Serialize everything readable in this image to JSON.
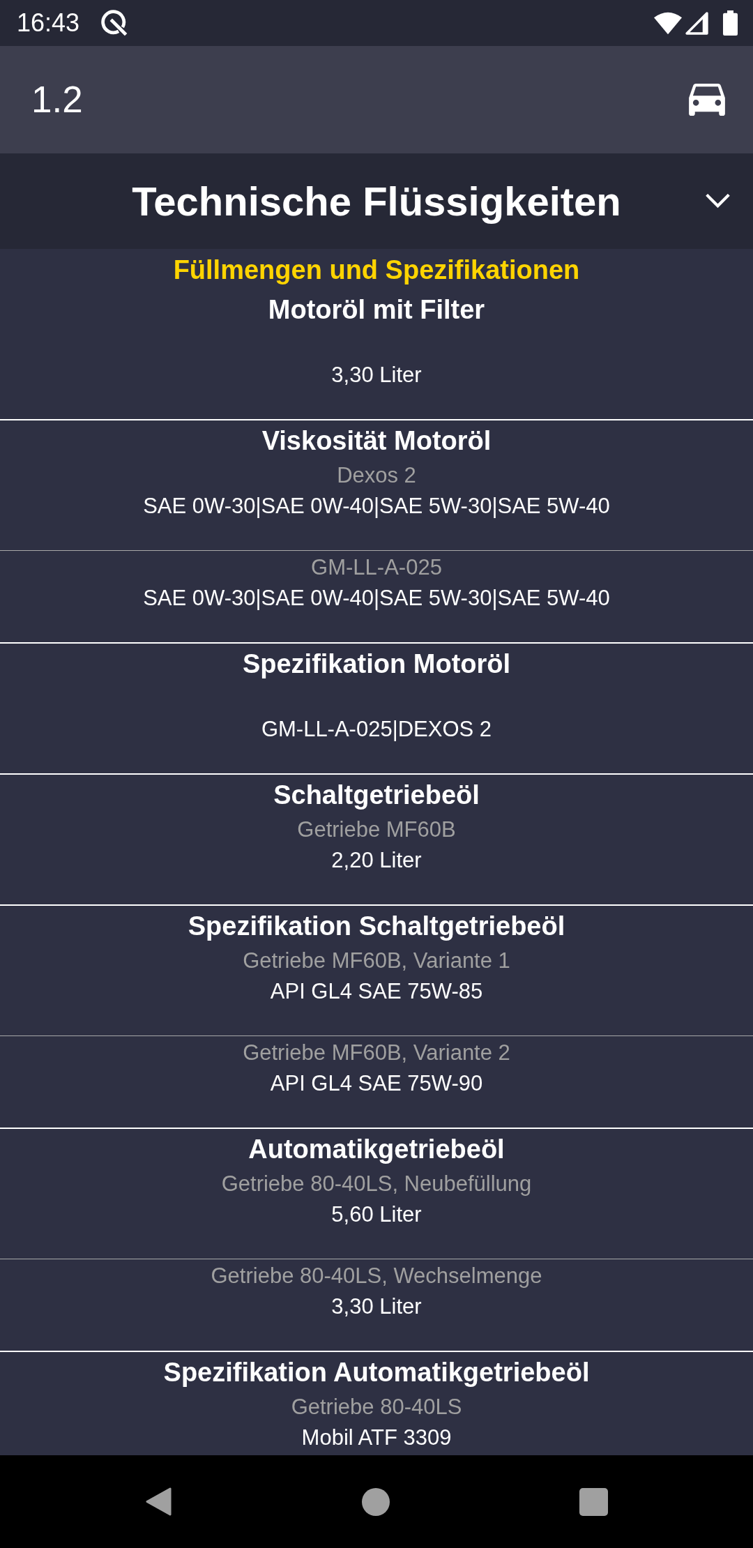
{
  "status_bar": {
    "time": "16:43"
  },
  "toolbar": {
    "title": "1.2"
  },
  "category": {
    "title": "Technische Flüssigkeiten",
    "expanded": true
  },
  "section": {
    "heading": "Füllmengen und Spezifikationen",
    "groups": [
      {
        "title": "Motoröl mit Filter",
        "entries": [
          {
            "value": "3,30 Liter"
          }
        ]
      },
      {
        "title": "Viskosität Motoröl",
        "entries": [
          {
            "subtitle": "Dexos 2",
            "value": "SAE 0W-30|SAE 0W-40|SAE 5W-30|SAE 5W-40"
          },
          {
            "subtitle": "GM-LL-A-025",
            "value": "SAE 0W-30|SAE 0W-40|SAE 5W-30|SAE 5W-40"
          }
        ]
      },
      {
        "title": "Spezifikation Motoröl",
        "entries": [
          {
            "value": "GM-LL-A-025|DEXOS 2"
          }
        ]
      },
      {
        "title": "Schaltgetriebeöl",
        "entries": [
          {
            "subtitle": "Getriebe MF60B",
            "value": "2,20 Liter"
          }
        ]
      },
      {
        "title": "Spezifikation Schaltgetriebeöl",
        "entries": [
          {
            "subtitle": "Getriebe MF60B, Variante 1",
            "value": "API GL4 SAE 75W-85"
          },
          {
            "subtitle": "Getriebe MF60B, Variante 2",
            "value": "API GL4 SAE 75W-90"
          }
        ]
      },
      {
        "title": "Automatikgetriebeöl",
        "entries": [
          {
            "subtitle": "Getriebe 80-40LS, Neubefüllung",
            "value": "5,60 Liter"
          },
          {
            "subtitle": "Getriebe 80-40LS, Wechselmenge",
            "value": "3,30 Liter"
          }
        ]
      },
      {
        "title": "Spezifikation Automatikgetriebeöl",
        "entries": [
          {
            "subtitle": "Getriebe 80-40LS",
            "value": "Mobil ATF 3309"
          }
        ]
      }
    ]
  }
}
